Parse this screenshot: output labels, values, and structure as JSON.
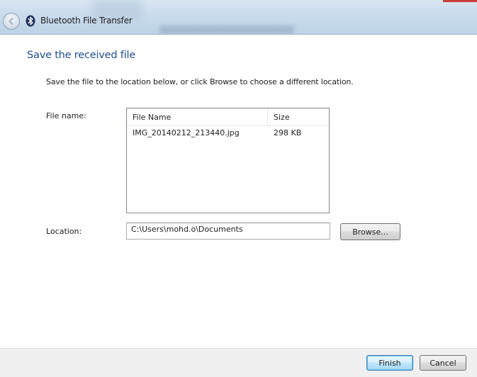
{
  "window": {
    "title": "Bluetooth File Transfer"
  },
  "icons": {
    "back": "back-arrow-icon",
    "bluetooth": "bluetooth-icon"
  },
  "main": {
    "heading": "Save the received file",
    "instruction": "Save the file to the location below, or click Browse to choose a different location.",
    "file_name_label": "File name:",
    "location_label": "Location:"
  },
  "file_list": {
    "columns": [
      "File Name",
      "Size"
    ],
    "rows": [
      {
        "name": "IMG_20140212_213440.jpg",
        "size": "298 KB"
      }
    ]
  },
  "location": {
    "value": "C:\\Users\\mohd.o\\Documents",
    "browse_label": "Browse..."
  },
  "footer": {
    "finish_label": "Finish",
    "cancel_label": "Cancel"
  },
  "colors": {
    "heading": "#1f4e8c",
    "titlebar": "#c9dbec",
    "footer": "#f0f0f0",
    "default_button_border": "#3c7fb1"
  }
}
